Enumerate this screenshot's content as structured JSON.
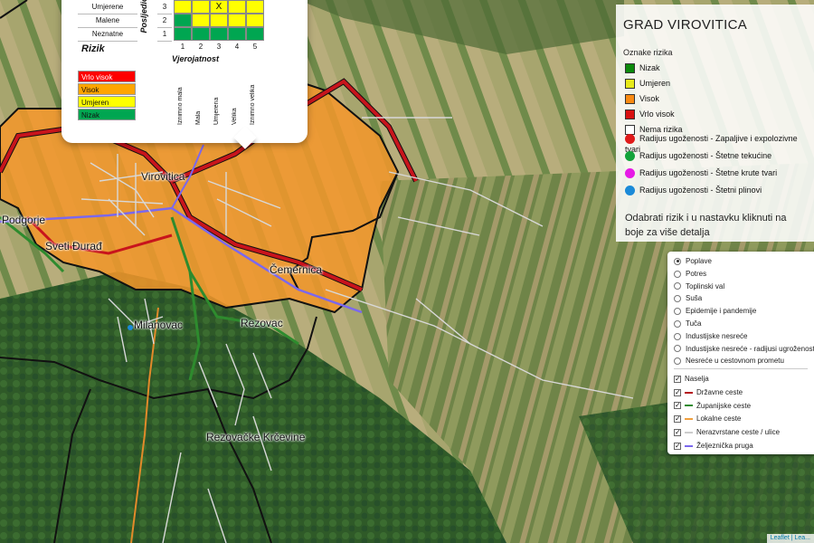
{
  "places": {
    "virovitica": "Virovitica",
    "podgorje": "Podgorje",
    "sveti_durad": "Sveti Đurađ",
    "cemernica": "Čemernica",
    "milanovac": "Milanovac",
    "rezovac": "Rezovac",
    "rezovacke_krcevine": "Rezovačke Krčevine"
  },
  "popup": {
    "severity_title": "Posljedice",
    "probability_title": "Vjerojatnost",
    "risk_title": "Rizik",
    "severity_rows": [
      {
        "label": "Umjerene",
        "level": "3",
        "colors": [
          "#ffff00",
          "#ffff00",
          "#ffff00",
          "#ffff00",
          "#ffff00"
        ],
        "mark_col": 2,
        "mark": "X"
      },
      {
        "label": "Malene",
        "level": "2",
        "colors": [
          "#00a651",
          "#ffff00",
          "#ffff00",
          "#ffff00",
          "#ffff00"
        ]
      },
      {
        "label": "Neznatne",
        "level": "1",
        "colors": [
          "#00a651",
          "#00a651",
          "#00a651",
          "#00a651",
          "#00a651"
        ]
      }
    ],
    "top_row_partial": [
      "#ffff00",
      "#ffa500",
      "#ffa500",
      "#ffa500",
      "#ffa500"
    ],
    "probability_levels": [
      "1",
      "2",
      "3",
      "4",
      "5"
    ],
    "probability_names": [
      "Iznimno mala",
      "Mala",
      "Umjerena",
      "Velika",
      "Iznimno velika"
    ],
    "risk_legend": [
      {
        "label": "Vrlo visok",
        "color": "#ff0000"
      },
      {
        "label": "Visok",
        "color": "#ffa500"
      },
      {
        "label": "Umjeren",
        "color": "#ffff00"
      },
      {
        "label": "Nizak",
        "color": "#00a651"
      }
    ]
  },
  "legend": {
    "title": "GRAD VIROVITICA",
    "subtitle": "Oznake rizika",
    "risk_items": [
      {
        "label": "Nizak",
        "color": "#0c8a0c"
      },
      {
        "label": "Umjeren",
        "color": "#e8ea1a"
      },
      {
        "label": "Visok",
        "color": "#f98a12"
      },
      {
        "label": "Vrlo visok",
        "color": "#d81010"
      },
      {
        "label": "Nema rizika",
        "color": "#ffffff"
      }
    ],
    "radius_items": [
      {
        "label": "Radijus ugoženosti - Zapaljive i expolozivne tvari",
        "color": "#e01a1a"
      },
      {
        "label": "Radijus ugoženosti - Štetne tekućine",
        "color": "#14a33a"
      },
      {
        "label": "Radijus ugoženosti - Štetne krute tvari",
        "color": "#e61ae6"
      },
      {
        "label": "Radijus ugoženosti - Štetni plinovi",
        "color": "#1a8ad8"
      }
    ],
    "note": "Odabrati rizik i u nastavku kliknuti na boje za više detalja"
  },
  "layers": {
    "risks": [
      {
        "label": "Poplave",
        "selected": true
      },
      {
        "label": "Potres",
        "selected": false
      },
      {
        "label": "Toplinski val",
        "selected": false
      },
      {
        "label": "Suša",
        "selected": false
      },
      {
        "label": "Epidemije i pandemije",
        "selected": false
      },
      {
        "label": "Tuča",
        "selected": false
      },
      {
        "label": "Industijske nesreće",
        "selected": false
      },
      {
        "label": "Industijske nesreće - radijusi ugroženosti",
        "selected": false
      },
      {
        "label": "Nesreće u cestovnom prometu",
        "selected": false
      }
    ],
    "overlays": [
      {
        "label": "Naselja",
        "checked": true,
        "color": ""
      },
      {
        "label": "Državne ceste",
        "checked": true,
        "color": "#b5121b"
      },
      {
        "label": "Županijske ceste",
        "checked": true,
        "color": "#2e8b2e"
      },
      {
        "label": "Lokalne ceste",
        "checked": true,
        "color": "#f0a040"
      },
      {
        "label": "Nerazvrstane ceste / ulice",
        "checked": true,
        "color": "#cccccc"
      },
      {
        "label": "Željeznička pruga",
        "checked": true,
        "color": "#7b68ee"
      }
    ]
  },
  "attribution": "Leaflet | Lea..."
}
